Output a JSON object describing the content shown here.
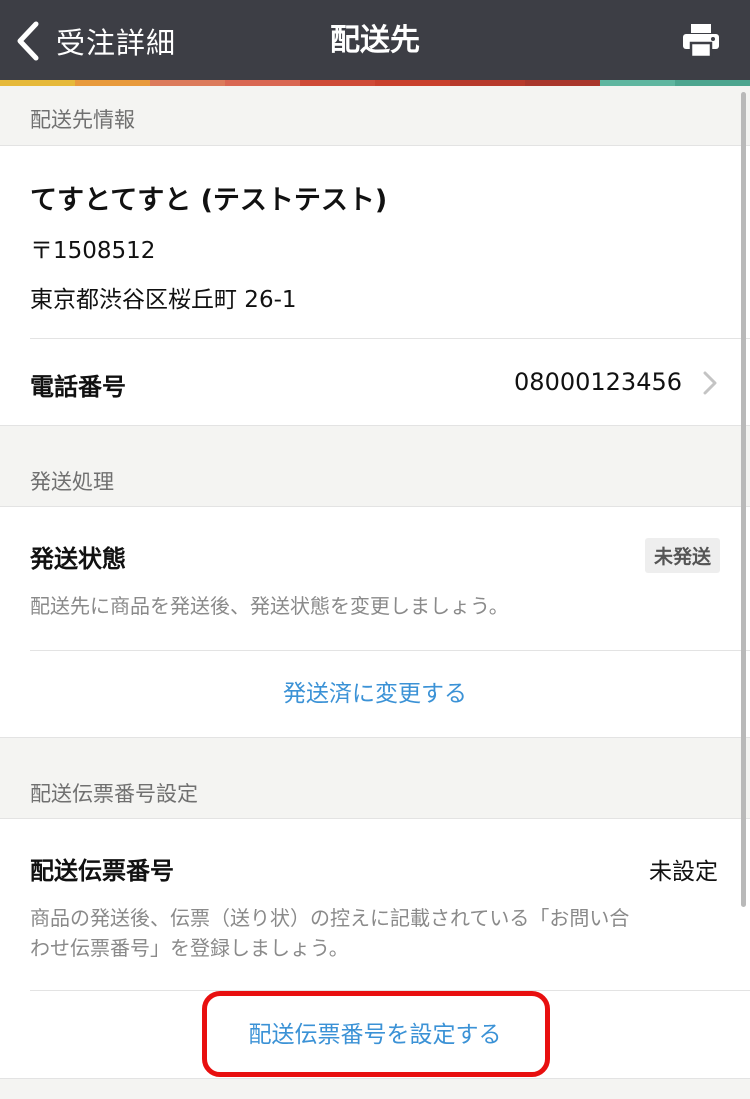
{
  "nav": {
    "back_label": "受注詳細",
    "title": "配送先",
    "icons": {
      "back": "chevron-left-icon",
      "print": "printer-icon"
    }
  },
  "colors": {
    "nav_bg": "#3d3e45",
    "link": "#3b92d6",
    "highlight": "#e80f0f",
    "stripe": [
      "#e6b93a",
      "#e89a3c",
      "#dc7b5c",
      "#d96753",
      "#cf4a37",
      "#c9402d",
      "#b73a2c",
      "#a9362c",
      "#5fb6a0",
      "#4da58f"
    ]
  },
  "shipping_info": {
    "header": "配送先情報",
    "name": "てすとてすと (テストテスト)",
    "postal": "〒1508512",
    "address": "東京都渋谷区桜丘町 26-1",
    "phone_label": "電話番号",
    "phone_value": "08000123456"
  },
  "shipping_process": {
    "header": "発送処理",
    "status_label": "発送状態",
    "status_badge": "未発送",
    "description": "配送先に商品を発送後、発送状態を変更しましょう。",
    "action_label": "発送済に変更する"
  },
  "tracking": {
    "header": "配送伝票番号設定",
    "label": "配送伝票番号",
    "value": "未設定",
    "description_line1": "商品の発送後、伝票（送り状）の控えに記載されている「お問い合",
    "description_line2": "わせ伝票番号」を登録しましょう。",
    "action_label": "配送伝票番号を設定する"
  }
}
